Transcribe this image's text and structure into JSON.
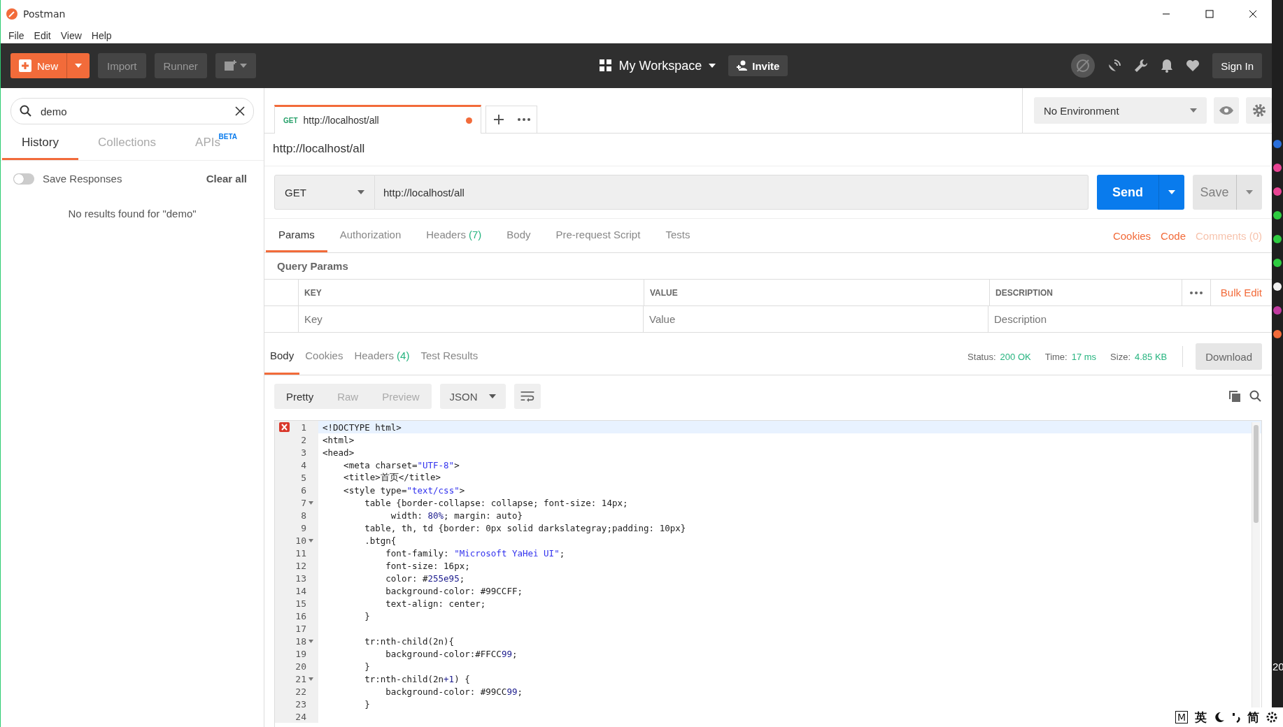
{
  "window": {
    "title": "Postman"
  },
  "menu": [
    "File",
    "Edit",
    "View",
    "Help"
  ],
  "header": {
    "new_label": "New",
    "import": "Import",
    "runner": "Runner",
    "workspace": "My Workspace",
    "invite": "Invite",
    "sign_in": "Sign In"
  },
  "sidebar": {
    "search": {
      "value": "demo"
    },
    "tabs": [
      {
        "label": "History",
        "selected": true
      },
      {
        "label": "Collections",
        "selected": false
      },
      {
        "label": "APIs",
        "badge": "BETA",
        "selected": false
      }
    ],
    "save_responses": {
      "label": "Save Responses",
      "on": false
    },
    "clear_all": "Clear all",
    "empty_message": "No results found for \"demo\""
  },
  "request_tab": {
    "method": "GET",
    "title": "http://localhost/all",
    "unsaved": true
  },
  "environment": "No Environment",
  "request": {
    "name": "http://localhost/all",
    "method": "GET",
    "url": "http://localhost/all",
    "send": "Send",
    "save": "Save"
  },
  "request_tabs": [
    {
      "label": "Params",
      "selected": true
    },
    {
      "label": "Authorization",
      "selected": false
    },
    {
      "label": "Headers",
      "count": "(7)",
      "selected": false
    },
    {
      "label": "Body",
      "selected": false
    },
    {
      "label": "Pre-request Script",
      "selected": false
    },
    {
      "label": "Tests",
      "selected": false
    }
  ],
  "request_links": [
    {
      "label": "Cookies",
      "disabled": false
    },
    {
      "label": "Code",
      "disabled": false
    },
    {
      "label": "Comments (0)",
      "disabled": true
    }
  ],
  "query_params": {
    "title": "Query Params",
    "columns": [
      "KEY",
      "VALUE",
      "DESCRIPTION"
    ],
    "bulk_edit": "Bulk Edit",
    "placeholders": [
      "Key",
      "Value",
      "Description"
    ]
  },
  "response": {
    "tabs": [
      {
        "label": "Body",
        "selected": true
      },
      {
        "label": "Cookies",
        "selected": false
      },
      {
        "label": "Headers",
        "count": "(4)",
        "selected": false
      },
      {
        "label": "Test Results",
        "selected": false
      }
    ],
    "status_label": "Status:",
    "status": "200 OK",
    "time_label": "Time:",
    "time": "17 ms",
    "size_label": "Size:",
    "size": "4.85 KB",
    "download": "Download",
    "view_modes": [
      {
        "label": "Pretty",
        "selected": true
      },
      {
        "label": "Raw",
        "selected": false
      },
      {
        "label": "Preview",
        "selected": false
      }
    ],
    "format": "JSON",
    "code_lines": [
      {
        "number": "1",
        "error": true,
        "active": true,
        "foldable": false,
        "segments": [
          {
            "kind": "plain",
            "text": "<!DOCTYPE html>"
          }
        ]
      },
      {
        "number": "2",
        "error": false,
        "active": false,
        "foldable": false,
        "segments": [
          {
            "kind": "plain",
            "text": "<html>"
          }
        ]
      },
      {
        "number": "3",
        "error": false,
        "active": false,
        "foldable": false,
        "segments": [
          {
            "kind": "plain",
            "text": "<head>"
          }
        ]
      },
      {
        "number": "4",
        "error": false,
        "active": false,
        "foldable": false,
        "segments": [
          {
            "kind": "plain",
            "text": "    <meta charset="
          },
          {
            "kind": "string",
            "text": "\"UTF-8\""
          },
          {
            "kind": "plain",
            "text": ">"
          }
        ]
      },
      {
        "number": "5",
        "error": false,
        "active": false,
        "foldable": false,
        "segments": [
          {
            "kind": "plain",
            "text": "    <title>首页</title>"
          }
        ]
      },
      {
        "number": "6",
        "error": false,
        "active": false,
        "foldable": false,
        "segments": [
          {
            "kind": "plain",
            "text": "    <style type="
          },
          {
            "kind": "string",
            "text": "\"text/css\""
          },
          {
            "kind": "plain",
            "text": ">"
          }
        ]
      },
      {
        "number": "7",
        "error": false,
        "active": false,
        "foldable": true,
        "segments": [
          {
            "kind": "plain",
            "text": "        table {border-collapse: collapse; font-size: 14px;"
          }
        ]
      },
      {
        "number": "8",
        "error": false,
        "active": false,
        "foldable": false,
        "segments": [
          {
            "kind": "plain",
            "text": "             width: "
          },
          {
            "kind": "number",
            "text": "80%"
          },
          {
            "kind": "plain",
            "text": "; margin: auto}"
          }
        ]
      },
      {
        "number": "9",
        "error": false,
        "active": false,
        "foldable": false,
        "segments": [
          {
            "kind": "plain",
            "text": "        table, th, td {border: 0px solid darkslategray;padding: 10px}"
          }
        ]
      },
      {
        "number": "10",
        "error": false,
        "active": false,
        "foldable": true,
        "segments": [
          {
            "kind": "plain",
            "text": "        .btgn{"
          }
        ]
      },
      {
        "number": "11",
        "error": false,
        "active": false,
        "foldable": false,
        "segments": [
          {
            "kind": "plain",
            "text": "            font-family: "
          },
          {
            "kind": "string",
            "text": "\"Microsoft YaHei UI\""
          },
          {
            "kind": "plain",
            "text": ";"
          }
        ]
      },
      {
        "number": "12",
        "error": false,
        "active": false,
        "foldable": false,
        "segments": [
          {
            "kind": "plain",
            "text": "            font-size: 16px;"
          }
        ]
      },
      {
        "number": "13",
        "error": false,
        "active": false,
        "foldable": false,
        "segments": [
          {
            "kind": "plain",
            "text": "            color: #"
          },
          {
            "kind": "number",
            "text": "255e95"
          },
          {
            "kind": "plain",
            "text": ";"
          }
        ]
      },
      {
        "number": "14",
        "error": false,
        "active": false,
        "foldable": false,
        "segments": [
          {
            "kind": "plain",
            "text": "            background-color: #99CCFF;"
          }
        ]
      },
      {
        "number": "15",
        "error": false,
        "active": false,
        "foldable": false,
        "segments": [
          {
            "kind": "plain",
            "text": "            text-align: center;"
          }
        ]
      },
      {
        "number": "16",
        "error": false,
        "active": false,
        "foldable": false,
        "segments": [
          {
            "kind": "plain",
            "text": "        }"
          }
        ]
      },
      {
        "number": "17",
        "error": false,
        "active": false,
        "foldable": false
      },
      {
        "number": "18",
        "error": false,
        "active": false,
        "foldable": true,
        "segments": [
          {
            "kind": "plain",
            "text": "        tr:nth-child(2n){"
          }
        ]
      },
      {
        "number": "19",
        "error": false,
        "active": false,
        "foldable": false,
        "segments": [
          {
            "kind": "plain",
            "text": "            background-color:#FFCC"
          },
          {
            "kind": "number",
            "text": "99"
          },
          {
            "kind": "plain",
            "text": ";"
          }
        ]
      },
      {
        "number": "20",
        "error": false,
        "active": false,
        "foldable": false,
        "segments": [
          {
            "kind": "plain",
            "text": "        }"
          }
        ]
      },
      {
        "number": "21",
        "error": false,
        "active": false,
        "foldable": true,
        "segments": [
          {
            "kind": "plain",
            "text": "        tr:nth-child(2n"
          },
          {
            "kind": "number",
            "text": "+1"
          },
          {
            "kind": "plain",
            "text": ") {"
          }
        ]
      },
      {
        "number": "22",
        "error": false,
        "active": false,
        "foldable": false,
        "segments": [
          {
            "kind": "plain",
            "text": "            background-color: #99CC"
          },
          {
            "kind": "number",
            "text": "99"
          },
          {
            "kind": "plain",
            "text": ";"
          }
        ]
      },
      {
        "number": "23",
        "error": false,
        "active": false,
        "foldable": false,
        "segments": [
          {
            "kind": "plain",
            "text": "        }"
          }
        ]
      },
      {
        "number": "24",
        "error": false,
        "active": false,
        "foldable": false
      }
    ]
  },
  "taskbar": {
    "clock": "20"
  },
  "ime": {
    "mode_key": "M",
    "language": "英",
    "script": "简"
  }
}
